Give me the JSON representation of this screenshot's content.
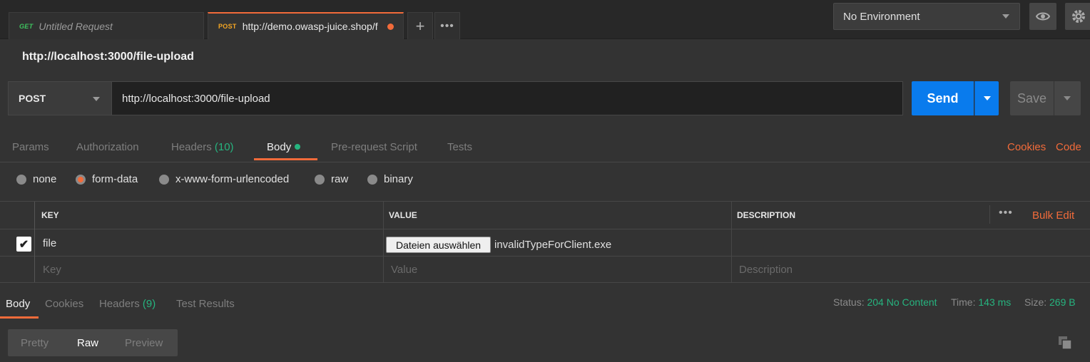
{
  "tabs": [
    {
      "method": "GET",
      "name": "Untitled Request"
    },
    {
      "method": "POST",
      "name": "http://demo.owasp-juice.shop/f"
    }
  ],
  "tab_actions": {
    "add": "+",
    "more": "•••"
  },
  "environment": {
    "selected": "No Environment"
  },
  "request": {
    "title": "http://localhost:3000/file-upload",
    "method": "POST",
    "url": "http://localhost:3000/file-upload",
    "send_label": "Send",
    "save_label": "Save"
  },
  "request_tabs": {
    "params": "Params",
    "authorization": "Authorization",
    "headers": "Headers",
    "headers_count": "(10)",
    "body": "Body",
    "prerequest": "Pre-request Script",
    "tests": "Tests",
    "cookies_link": "Cookies",
    "code_link": "Code"
  },
  "body_types": {
    "none": "none",
    "form_data": "form-data",
    "urlencoded": "x-www-form-urlencoded",
    "raw": "raw",
    "binary": "binary",
    "selected": "form-data"
  },
  "table": {
    "headers": {
      "key": "KEY",
      "value": "VALUE",
      "description": "DESCRIPTION"
    },
    "more": "•••",
    "bulk_edit": "Bulk Edit",
    "row": {
      "checked": true,
      "key": "file",
      "file_button": "Dateien auswählen",
      "file_name": "invalidTypeForClient.exe"
    },
    "placeholders": {
      "key": "Key",
      "value": "Value",
      "description": "Description"
    }
  },
  "response": {
    "tabs": {
      "body": "Body",
      "cookies": "Cookies",
      "headers": "Headers",
      "headers_count": "(9)",
      "test_results": "Test Results"
    },
    "status_label": "Status:",
    "status_value": "204 No Content",
    "time_label": "Time:",
    "time_value": "143 ms",
    "size_label": "Size:",
    "size_value": "269 B",
    "view_modes": {
      "pretty": "Pretty",
      "raw": "Raw",
      "preview": "Preview",
      "selected": "Raw"
    }
  },
  "colors": {
    "accent": "#f26b3a",
    "send": "#097bed",
    "success": "#26b47f"
  }
}
